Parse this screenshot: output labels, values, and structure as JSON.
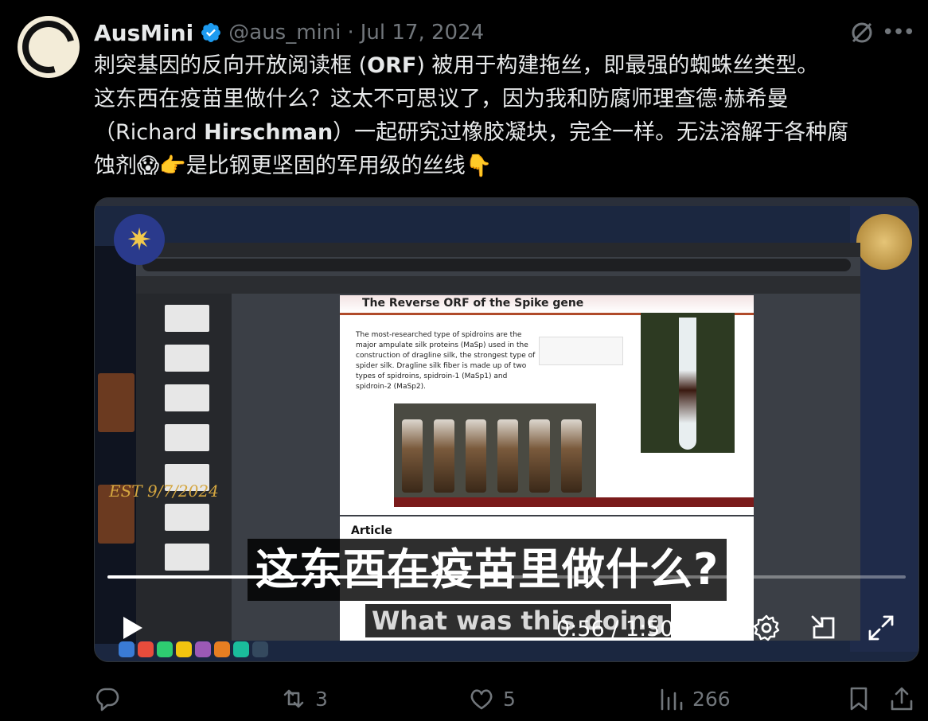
{
  "author": {
    "display_name": "AusMini",
    "handle": "@aus_mini",
    "separator": "·",
    "date": "Jul 17, 2024",
    "verified": true
  },
  "tweet": {
    "line1": "刺突基因的反向开放阅读框 (",
    "line1_bold": "ORF",
    "line1_end": ") 被用于构建拖丝，即最强的蜘蛛丝类型。",
    "line2": "这东西在疫苗里做什么？这太不可思议了，因为我和防腐师理查德·赫希曼",
    "line3_start": "（Richard ",
    "line3_bold": "Hirschman",
    "line3_end": "）一起研究过橡胶凝块，完全一样。无法溶解于各种腐",
    "line4": "蚀剂😱👉是比钢更坚固的军用级的丝线👇"
  },
  "video": {
    "subtitle_zh": "这东西在疫苗里做什么?",
    "subtitle_en": "What was this doing",
    "watermark": "EST 9/7/2024",
    "pdf_title": "The Reverse ORF of the Spike gene",
    "pdf_paragraph": "The most-researched type of spidroins are the major ampulate silk proteins (MaSp) used in the construction of dragline silk, the strongest type of spider silk. Dragline silk fiber is made up of two types of spidroins, spidroin-1 (MaSp1) and spidroin-2 (MaSp2).",
    "pdf_page2_heading": "Article",
    "time": "0:56 / 1:50",
    "progress": 0.509
  },
  "actions": {
    "replies": "",
    "reposts": "3",
    "likes": "5",
    "views": "266"
  },
  "colors": {
    "background": "#000000",
    "text": "#e7e9ea",
    "muted": "#71767b",
    "verified": "#1d9bf0"
  }
}
